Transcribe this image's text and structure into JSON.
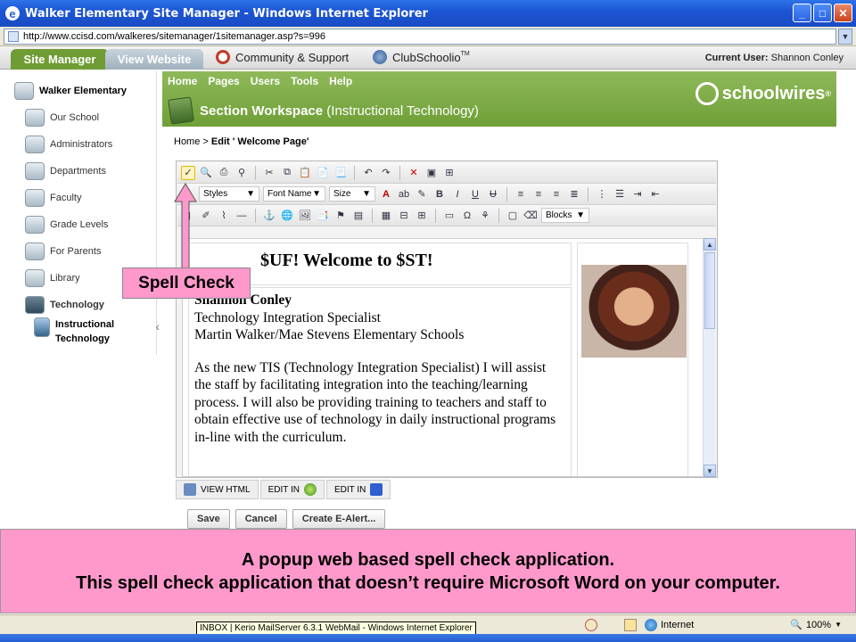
{
  "window": {
    "title": "Walker Elementary Site Manager - Windows Internet Explorer",
    "address": "http://www.ccisd.com/walkeres/sitemanager/1sitemanager.asp?s=996",
    "controls": [
      "_",
      "□",
      "✕"
    ]
  },
  "topbar": {
    "tab_site_manager": "Site Manager",
    "tab_view_website": "View Website",
    "community": "Community & Support",
    "clubschoolio": "ClubSchoolio",
    "tm": "TM",
    "current_user_label": "Current User:",
    "current_user_name": "Shannon Conley"
  },
  "sidebar": {
    "root": "Walker Elementary",
    "items": [
      {
        "label": "Our School"
      },
      {
        "label": "Administrators"
      },
      {
        "label": "Departments"
      },
      {
        "label": "Faculty"
      },
      {
        "label": "Grade Levels"
      },
      {
        "label": "For Parents"
      },
      {
        "label": "Library"
      },
      {
        "label": "Technology"
      }
    ],
    "sub_line1": "Instructional",
    "sub_line2": "Technology",
    "collapse": "‹"
  },
  "header": {
    "menu": [
      "Home",
      "Pages",
      "Users",
      "Tools",
      "Help"
    ],
    "section_title": "Section Workspace",
    "section_sub": "(Instructional Technology)",
    "logo_text": "schoolwires",
    "logo_mark": "®"
  },
  "breadcrumb": {
    "home": "Home",
    "sep": ">",
    "current": "Edit ' Welcome Page'"
  },
  "toolbar": {
    "styles": "Styles",
    "font_name": "Font Name",
    "size": "Size",
    "blocks": "Blocks"
  },
  "content": {
    "heading": "$UF! Welcome to $ST!",
    "name": "Shannon Conley",
    "line2": "Technology Integration Specialist",
    "line3": "Martin Walker/Mae Stevens Elementary Schools",
    "paragraph": "As the new TIS (Technology Integration Specialist) I will assist the staff by facilitating integration into the teaching/learning process. I will also be providing training to teachers and staff to obtain effective use of technology in daily instructional programs in-line with the curriculum."
  },
  "modes": [
    "VIEW HTML",
    "EDIT IN",
    "EDIT IN"
  ],
  "actions": {
    "save": "Save",
    "cancel": "Cancel",
    "alert": "Create E-Alert..."
  },
  "annotation": {
    "label": "Spell Check",
    "banner_line1": "A popup web based spell check application.",
    "banner_line2": "This spell check application that doesn’t require Microsoft Word on your computer."
  },
  "status": {
    "zone": "Internet",
    "zoom": "100%",
    "tooltip": "INBOX | Kerio MailServer 6.3.1 WebMail - Windows Internet Explorer"
  },
  "colors": {
    "titlebar": "#1c55d4",
    "header_green": "#7aab42",
    "annotation_pink": "#ff99cc"
  }
}
